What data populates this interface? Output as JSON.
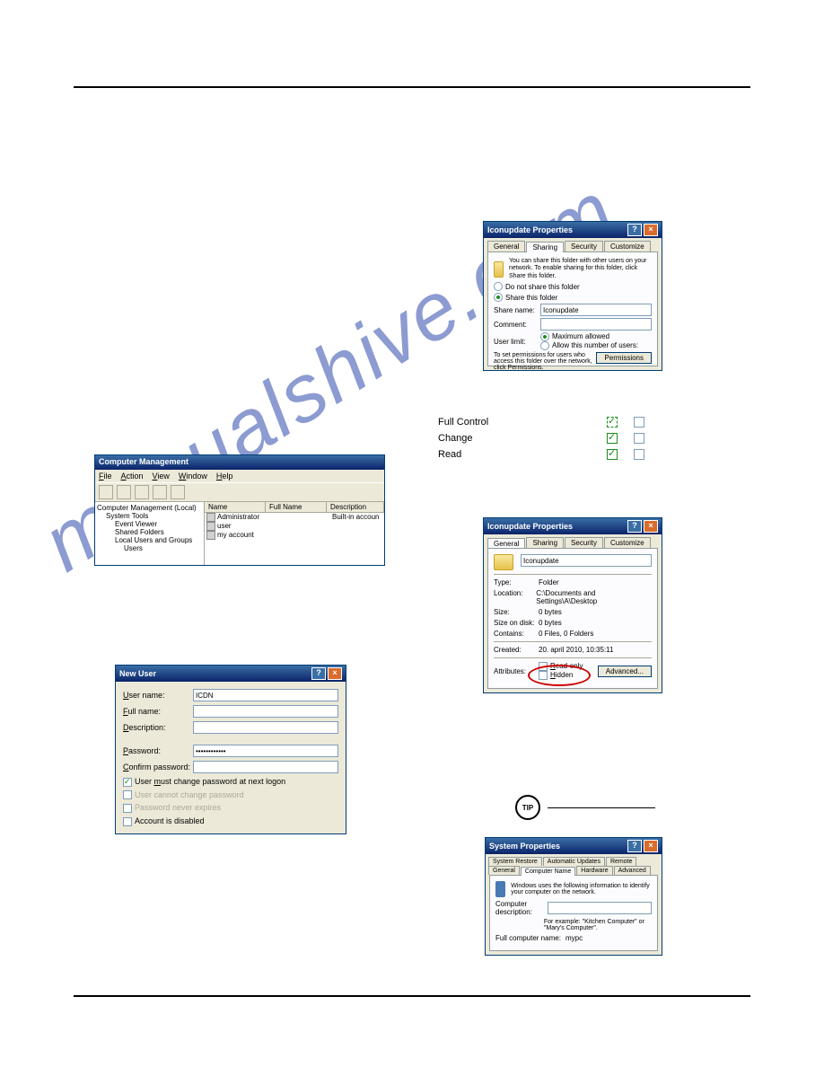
{
  "section_title": "",
  "watermark": "manualshive.com",
  "fig1": {
    "title": "Iconupdate Properties",
    "tabs": [
      "General",
      "Sharing",
      "Security",
      "Customize"
    ],
    "intro": "You can share this folder with other users on your network. To enable sharing for this folder, click Share this folder.",
    "r1": "Do not share this folder",
    "r2": "Share this folder",
    "share_name_label": "Share name:",
    "share_name_value": "Iconupdate",
    "comment_label": "Comment:",
    "user_limit_label": "User limit:",
    "ul_opt1": "Maximum allowed",
    "ul_opt2": "Allow this number of users:",
    "perm_text": "To set permissions for users who access this folder over the network, click Permissions.",
    "perm_btn": "Permissions"
  },
  "perm": {
    "rows": [
      {
        "name": "Full Control",
        "allow": true,
        "dashed": true
      },
      {
        "name": "Change",
        "allow": true
      },
      {
        "name": "Read",
        "allow": true
      }
    ]
  },
  "cm": {
    "title": "Computer Management",
    "menu": [
      "File",
      "Action",
      "View",
      "Window",
      "Help"
    ],
    "tree_root": "Computer Management (Local)",
    "tree": [
      "System Tools",
      "Event Viewer",
      "Shared Folders",
      "Local Users and Groups",
      "Users"
    ],
    "cols": [
      "Name",
      "Full Name",
      "Description"
    ],
    "rows": [
      {
        "name": "Administrator",
        "full": "",
        "desc": "Built-in accoun"
      },
      {
        "name": "user",
        "full": "",
        "desc": ""
      },
      {
        "name": "my account",
        "full": "",
        "desc": ""
      }
    ]
  },
  "nu": {
    "title": "New User",
    "username_label": "User name:",
    "username_value": "ICDN",
    "fullname_label": "Full name:",
    "desc_label": "Description:",
    "password_label": "Password:",
    "password_value": "••••••••••••",
    "confirm_label": "Confirm password:",
    "chk1": "User must change password at next logon",
    "chk2": "User cannot change password",
    "chk3": "Password never expires",
    "chk4": "Account is disabled"
  },
  "gen": {
    "title": "Iconupdate Properties",
    "tabs": [
      "General",
      "Sharing",
      "Security",
      "Customize"
    ],
    "name": "Iconupdate",
    "rows": [
      [
        "Type:",
        "Folder"
      ],
      [
        "Location:",
        "C:\\Documents and Settings\\A\\Desktop"
      ],
      [
        "Size:",
        "0 bytes"
      ],
      [
        "Size on disk:",
        "0 bytes"
      ],
      [
        "Contains:",
        "0 Files, 0 Folders"
      ],
      [
        "Created:",
        "20. april 2010, 10:35:11"
      ]
    ],
    "attr_label": "Attributes:",
    "attr1": "Read-only",
    "attr2": "Hidden",
    "adv_btn": "Advanced..."
  },
  "tip_label": "TIP",
  "sp": {
    "title": "System Properties",
    "tabs_top": [
      "System Restore",
      "Automatic Updates",
      "Remote"
    ],
    "tabs_bot": [
      "General",
      "Computer Name",
      "Hardware",
      "Advanced"
    ],
    "intro": "Windows uses the following information to identify your computer on the network.",
    "desc_label": "Computer description:",
    "example": "For example: \"Kitchen Computer\" or \"Mary's Computer\".",
    "full_label": "Full computer name:",
    "full_value": "mypc"
  }
}
